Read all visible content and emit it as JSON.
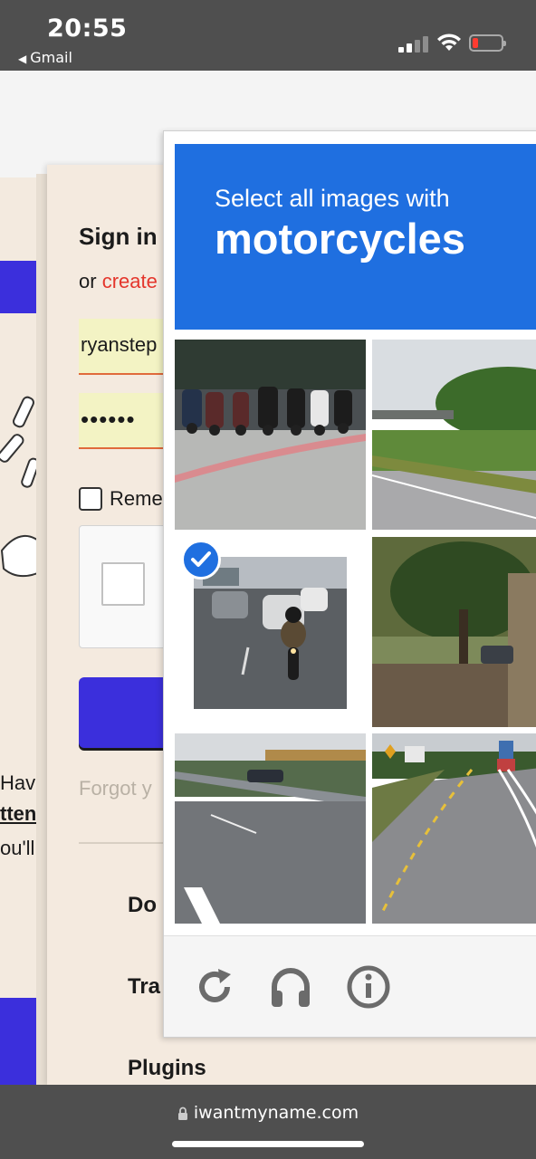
{
  "status_bar": {
    "time": "20:55",
    "back_app": "Gmail"
  },
  "login": {
    "title": "Sign in",
    "or_text": "or ",
    "create_text": "create",
    "username_value": "ryanstep",
    "password_value": "••••••",
    "remember_label": "Reme",
    "forgot_text": "Forgot y",
    "menu": [
      "Do",
      "Tra",
      "Plugins"
    ]
  },
  "left_partial_text": [
    "Have",
    "ttens",
    "ou'll"
  ],
  "captcha": {
    "instruction": "Select all images with",
    "target": "motorcycles",
    "accent_color": "#1f6fe0",
    "tiles": [
      {
        "content": "scooters parked on curb",
        "selected": false
      },
      {
        "content": "highway road with trees",
        "selected": false
      },
      {
        "content": "motorcycle rider on street",
        "selected": true
      },
      {
        "content": "tree by roadside",
        "selected": false
      },
      {
        "content": "highway with guard rail",
        "selected": false
      },
      {
        "content": "curving road with markings",
        "selected": false
      }
    ],
    "footer_icons": [
      "reload-icon",
      "headphones-icon",
      "info-icon"
    ]
  },
  "url_bar": {
    "url": "iwantmyname.com"
  }
}
